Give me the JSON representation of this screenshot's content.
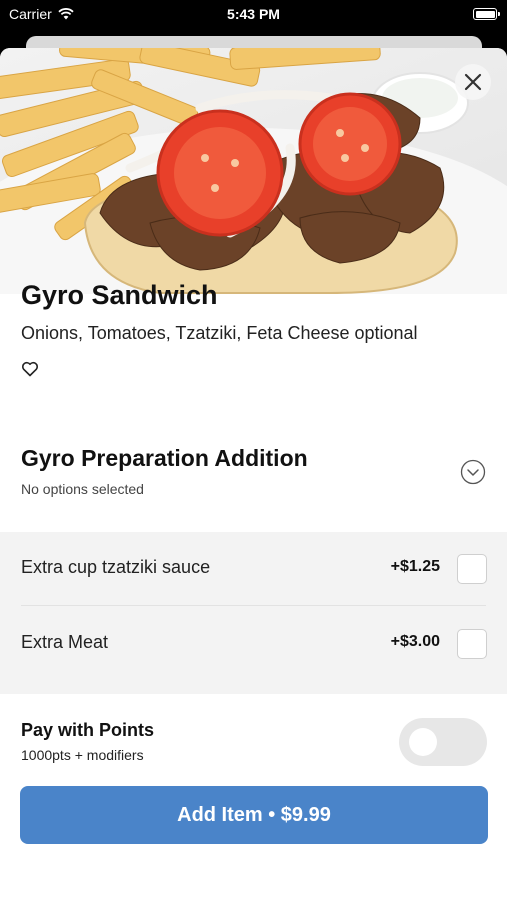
{
  "status_bar": {
    "carrier": "Carrier",
    "time": "5:43 PM"
  },
  "item": {
    "title": "Gyro Sandwich",
    "description": "Onions, Tomatoes, Tzatziki, Feta Cheese optional",
    "image_alt": "gyro-sandwich-with-fries-photo"
  },
  "modifier_group": {
    "title": "Gyro Preparation Addition",
    "subtitle": "No options selected",
    "options": [
      {
        "name": "Extra cup tzatziki sauce",
        "price": "+$1.25",
        "checked": false
      },
      {
        "name": "Extra Meat",
        "price": "+$3.00",
        "checked": false
      }
    ]
  },
  "points": {
    "title": "Pay with Points",
    "subtitle": "1000pts + modifiers",
    "enabled": false
  },
  "add_button": {
    "label": "Add Item • $9.99"
  },
  "colors": {
    "accent": "#4a84c9",
    "toggle_off": "#e7e7e7",
    "options_bg": "#f3f3f3"
  },
  "icons": [
    "wifi-icon",
    "battery-icon",
    "close-icon",
    "heart-icon",
    "chevron-down-circle-icon"
  ]
}
